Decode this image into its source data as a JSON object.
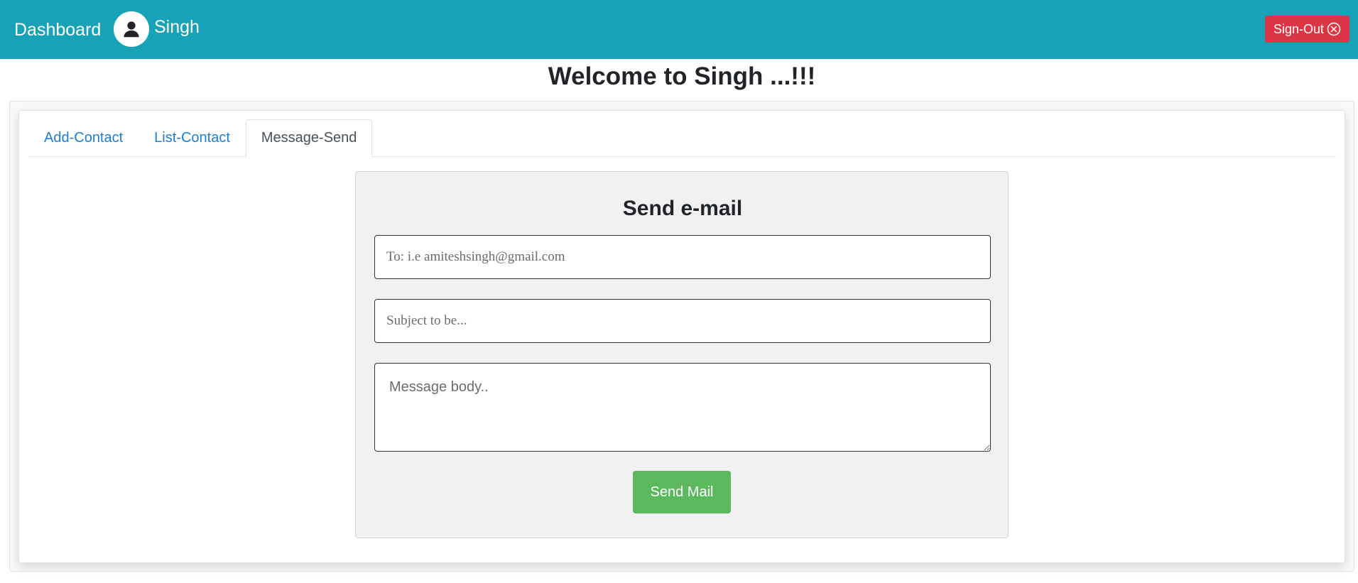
{
  "header": {
    "brand": "Dashboard",
    "user_name": "Singh",
    "avatar_icon": "user-icon",
    "signout_label": "Sign-Out",
    "signout_icon": "circle-x-icon",
    "colors": {
      "navbar": "#17a2b8",
      "signout": "#dc3545"
    }
  },
  "welcome": "Welcome to Singh ...!!!",
  "tabs": [
    {
      "label": "Add-Contact",
      "active": false
    },
    {
      "label": "List-Contact",
      "active": false
    },
    {
      "label": "Message-Send",
      "active": true
    }
  ],
  "mail_form": {
    "title": "Send e-mail",
    "to_value": "",
    "to_placeholder": "To: i.e amiteshsingh@gmail.com",
    "subject_value": "",
    "subject_placeholder": "Subject to be...",
    "body_value": "",
    "body_placeholder": "Message body..",
    "send_label": "Send Mail",
    "send_color": "#5cb85c"
  }
}
